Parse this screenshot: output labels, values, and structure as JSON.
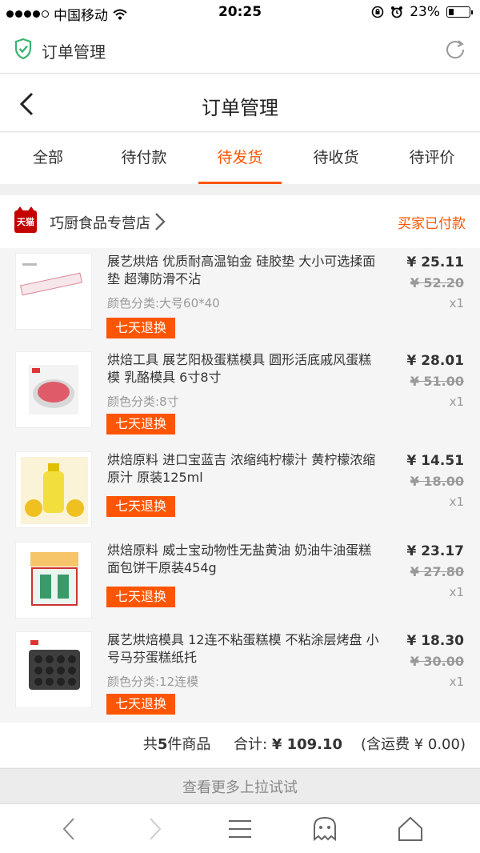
{
  "status_bar": {
    "carrier": "中国移动",
    "time": "20:25",
    "battery": "23%",
    "battery_level": 0.23
  },
  "browser": {
    "title": "订单管理"
  },
  "header": {
    "title": "订单管理"
  },
  "tabs": [
    {
      "label": "全部",
      "active": false
    },
    {
      "label": "待付款",
      "active": false
    },
    {
      "label": "待发货",
      "active": true
    },
    {
      "label": "待收货",
      "active": false
    },
    {
      "label": "待评价",
      "active": false
    }
  ],
  "shop": {
    "badge": "天猫",
    "name": "巧厨食品专营店",
    "status": "买家已付款"
  },
  "items": [
    {
      "title": "展艺烘焙 优质耐高温铂金 硅胶垫 大小可选揉面垫 超薄防滑不沾",
      "sku": "颜色分类:大号60*40",
      "badge": "七天退换",
      "price": "¥ 25.11",
      "original": "¥ 52.20",
      "qty": "x1"
    },
    {
      "title": "烘焙工具 展艺阳极蛋糕模具 圆形活底戚风蛋糕模 乳酪模具 6寸8寸",
      "sku": "颜色分类:8寸",
      "badge": "七天退换",
      "price": "¥ 28.01",
      "original": "¥ 51.00",
      "qty": "x1"
    },
    {
      "title": "烘焙原料 进口宝蓝吉 浓缩纯柠檬汁 黄柠檬浓缩原汁 原装125ml",
      "sku": "",
      "badge": "七天退换",
      "price": "¥ 14.51",
      "original": "¥ 18.00",
      "qty": "x1"
    },
    {
      "title": "烘焙原料 威士宝动物性无盐黄油 奶油牛油蛋糕面包饼干原装454g",
      "sku": "",
      "badge": "七天退换",
      "price": "¥ 23.17",
      "original": "¥ 27.80",
      "qty": "x1"
    },
    {
      "title": "展艺烘焙模具 12连不粘蛋糕模 不粘涂层烤盘 小号马芬蛋糕纸托",
      "sku": "颜色分类:12连模",
      "badge": "七天退换",
      "price": "¥ 18.30",
      "original": "¥ 30.00",
      "qty": "x1"
    }
  ],
  "summary": {
    "count_prefix": "共",
    "count": "5",
    "count_suffix": "件商品",
    "total_label": "合计:",
    "total": "¥ 109.10",
    "shipping": "(含运费 ¥ 0.00)"
  },
  "load_more": "查看更多上拉试试",
  "colors": {
    "accent": "#ff5500",
    "tmall": "#c40000",
    "shield": "#3cb371"
  }
}
